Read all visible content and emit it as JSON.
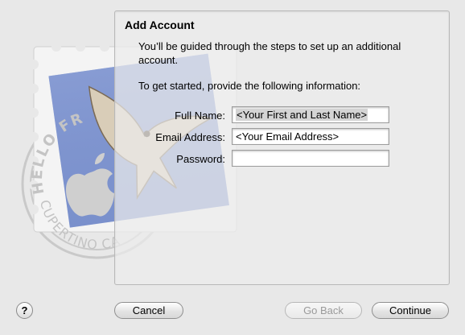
{
  "dialog": {
    "title": "Add Account",
    "intro": "You’ll be guided through the steps to set up an additional account.",
    "prompt": "To get started, provide the following information:"
  },
  "form": {
    "full_name_label": "Full Name:",
    "full_name_value": "<Your First and Last Name>",
    "email_label": "Email Address:",
    "email_value": "<Your Email Address>",
    "password_label": "Password:",
    "password_value": ""
  },
  "buttons": {
    "help": "?",
    "cancel": "Cancel",
    "go_back": "Go Back",
    "continue": "Continue"
  },
  "stamp": {
    "text_top": "HELLO FR",
    "text_bottom": "CUPERTINO CA",
    "icon": "eagle-stamp-icon"
  }
}
